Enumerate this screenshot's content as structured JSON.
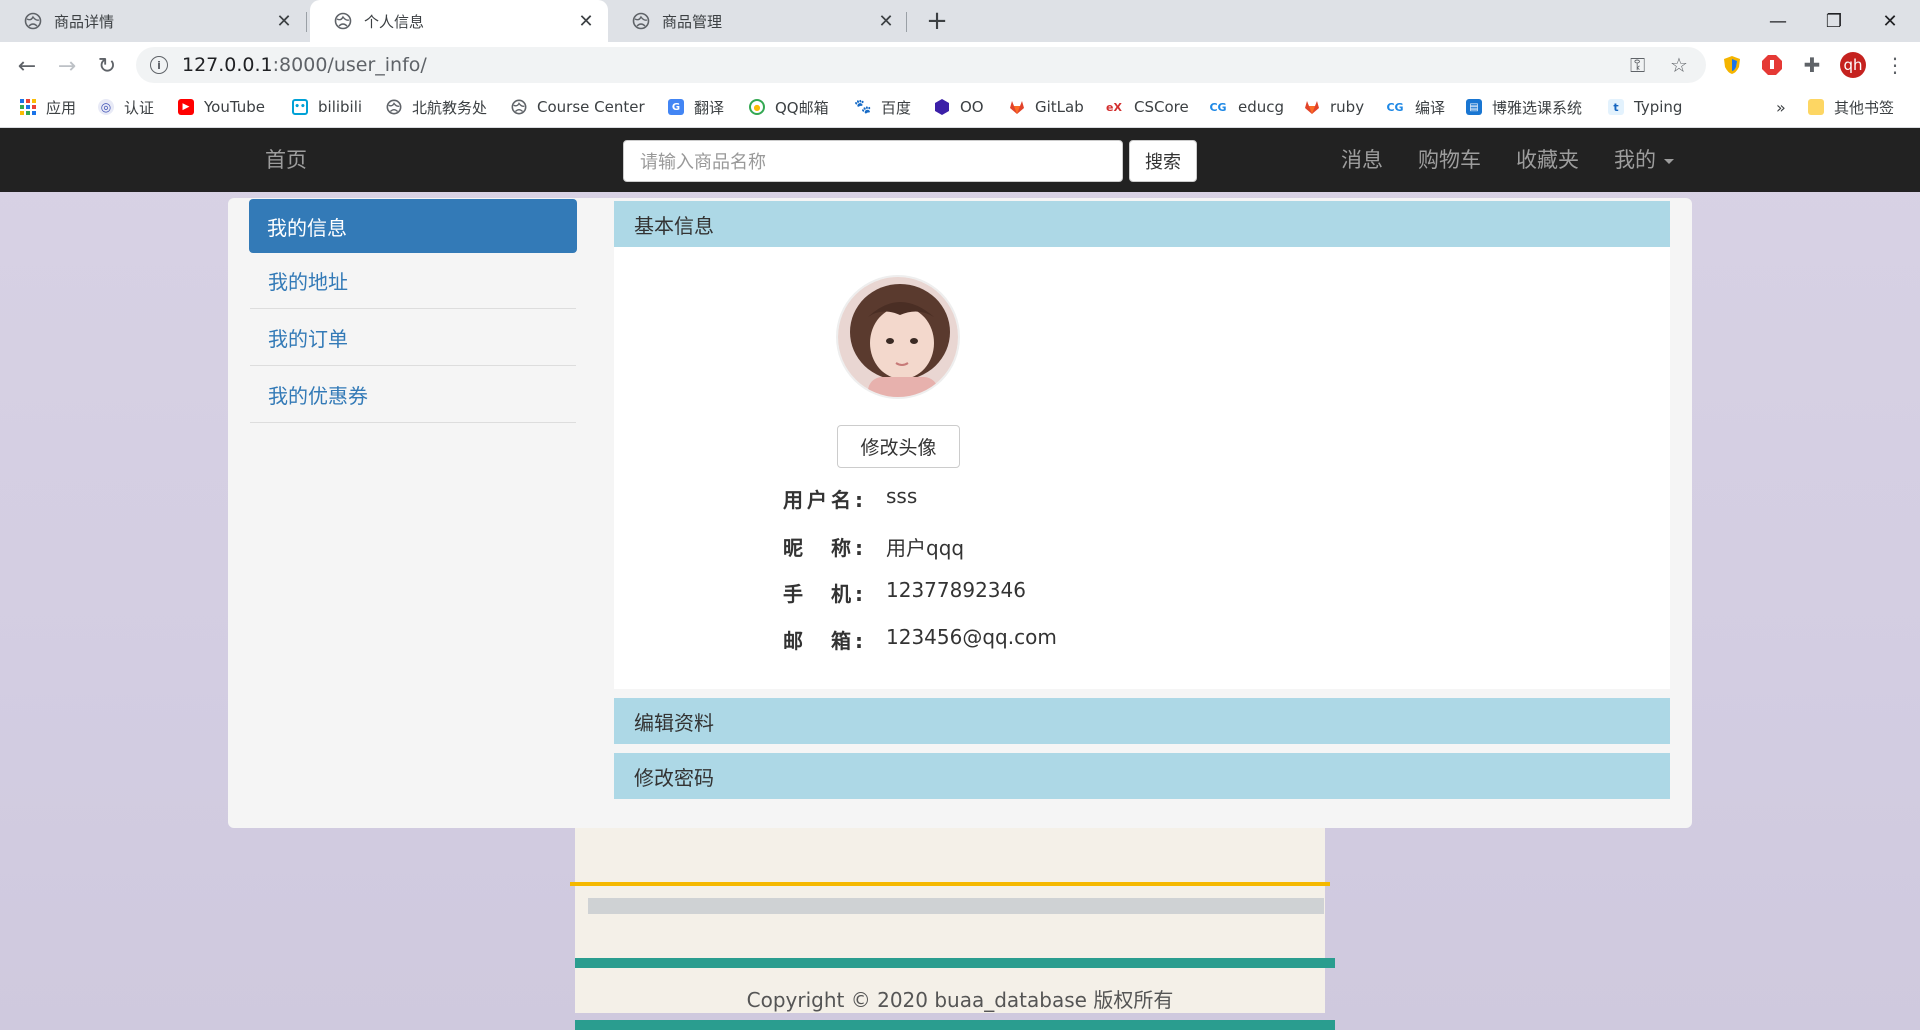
{
  "browser": {
    "tabs": [
      {
        "title": "商品详情",
        "active": false
      },
      {
        "title": "个人信息",
        "active": true
      },
      {
        "title": "商品管理",
        "active": false
      }
    ],
    "url_host": "127.0.0.1",
    "url_path": ":8000/user_info/",
    "profile_initials": "qh",
    "bookmarks": [
      {
        "label": "应用",
        "icon": "apps-grid-icon"
      },
      {
        "label": "认证",
        "icon": "auth-icon"
      },
      {
        "label": "YouTube",
        "icon": "youtube-icon"
      },
      {
        "label": "bilibili",
        "icon": "bilibili-icon"
      },
      {
        "label": "北航教务处",
        "icon": "globe-icon"
      },
      {
        "label": "Course Center",
        "icon": "globe-icon"
      },
      {
        "label": "翻译",
        "icon": "translate-icon"
      },
      {
        "label": "QQ邮箱",
        "icon": "qqmail-icon"
      },
      {
        "label": "百度",
        "icon": "baidu-paw-icon"
      },
      {
        "label": "OO",
        "icon": "hexagon-icon"
      },
      {
        "label": "GitLab",
        "icon": "gitlab-icon"
      },
      {
        "label": "CSCore",
        "icon": "cscore-icon"
      },
      {
        "label": "educg",
        "icon": "educg-icon"
      },
      {
        "label": "ruby",
        "icon": "gitlab-icon"
      },
      {
        "label": "编译",
        "icon": "educg-icon"
      },
      {
        "label": "博雅选课系统",
        "icon": "book-icon"
      },
      {
        "label": "Typing",
        "icon": "typing-icon"
      }
    ],
    "overflow_label": "»",
    "other_bookmarks": "其他书签"
  },
  "navbar": {
    "home": "首页",
    "search_placeholder": "请输入商品名称",
    "search_button": "搜索",
    "links": [
      "消息",
      "购物车",
      "收藏夹",
      "我的"
    ]
  },
  "sidebar": {
    "items": [
      {
        "label": "我的信息",
        "active": true
      },
      {
        "label": "我的地址",
        "active": false
      },
      {
        "label": "我的订单",
        "active": false
      },
      {
        "label": "我的优惠券",
        "active": false
      }
    ]
  },
  "main": {
    "basic_info_title": "基本信息",
    "change_avatar_button": "修改头像",
    "fields": [
      {
        "label": "用户名:",
        "value": "sss"
      },
      {
        "label": "昵　称:",
        "value": "用户qqq"
      },
      {
        "label": "手　机:",
        "value": "12377892346"
      },
      {
        "label": "邮　箱:",
        "value": "123456@qq.com"
      }
    ],
    "edit_profile_title": "编辑资料",
    "change_password_title": "修改密码"
  },
  "footer": {
    "copyright": "Copyright © 2020  buaa_database 版权所有"
  },
  "colors": {
    "navbar_bg": "#222222",
    "active_blue": "#337ab7",
    "section_header": "#add8e6"
  }
}
